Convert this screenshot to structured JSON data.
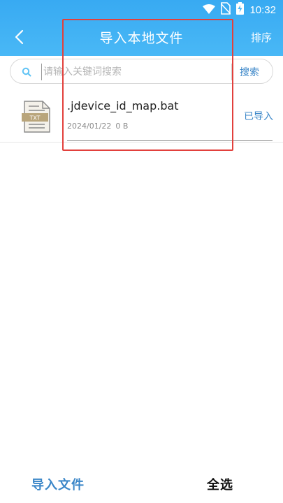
{
  "status_bar": {
    "time": "10:32",
    "icons": [
      "wifi-icon",
      "no-sim-icon",
      "battery-charging-icon"
    ]
  },
  "header": {
    "back_icon": "chevron-left-icon",
    "title": "导入本地文件",
    "sort_label": "排序"
  },
  "search": {
    "icon": "search-icon",
    "placeholder": "请输入关键词搜索",
    "button_label": "搜索"
  },
  "files": [
    {
      "icon": "txt-file-icon",
      "icon_text": "TXT",
      "name": ".jdevice_id_map.bat",
      "date": "2024/01/22",
      "size": "0 B",
      "status": "已导入"
    }
  ],
  "bottom": {
    "import_label": "导入文件",
    "select_all_label": "全选"
  },
  "colors": {
    "header_blue": "#45b4f5",
    "accent_blue": "#3a86c8",
    "highlight_red": "#e2403c",
    "file_icon_tan": "#b9a57b"
  }
}
